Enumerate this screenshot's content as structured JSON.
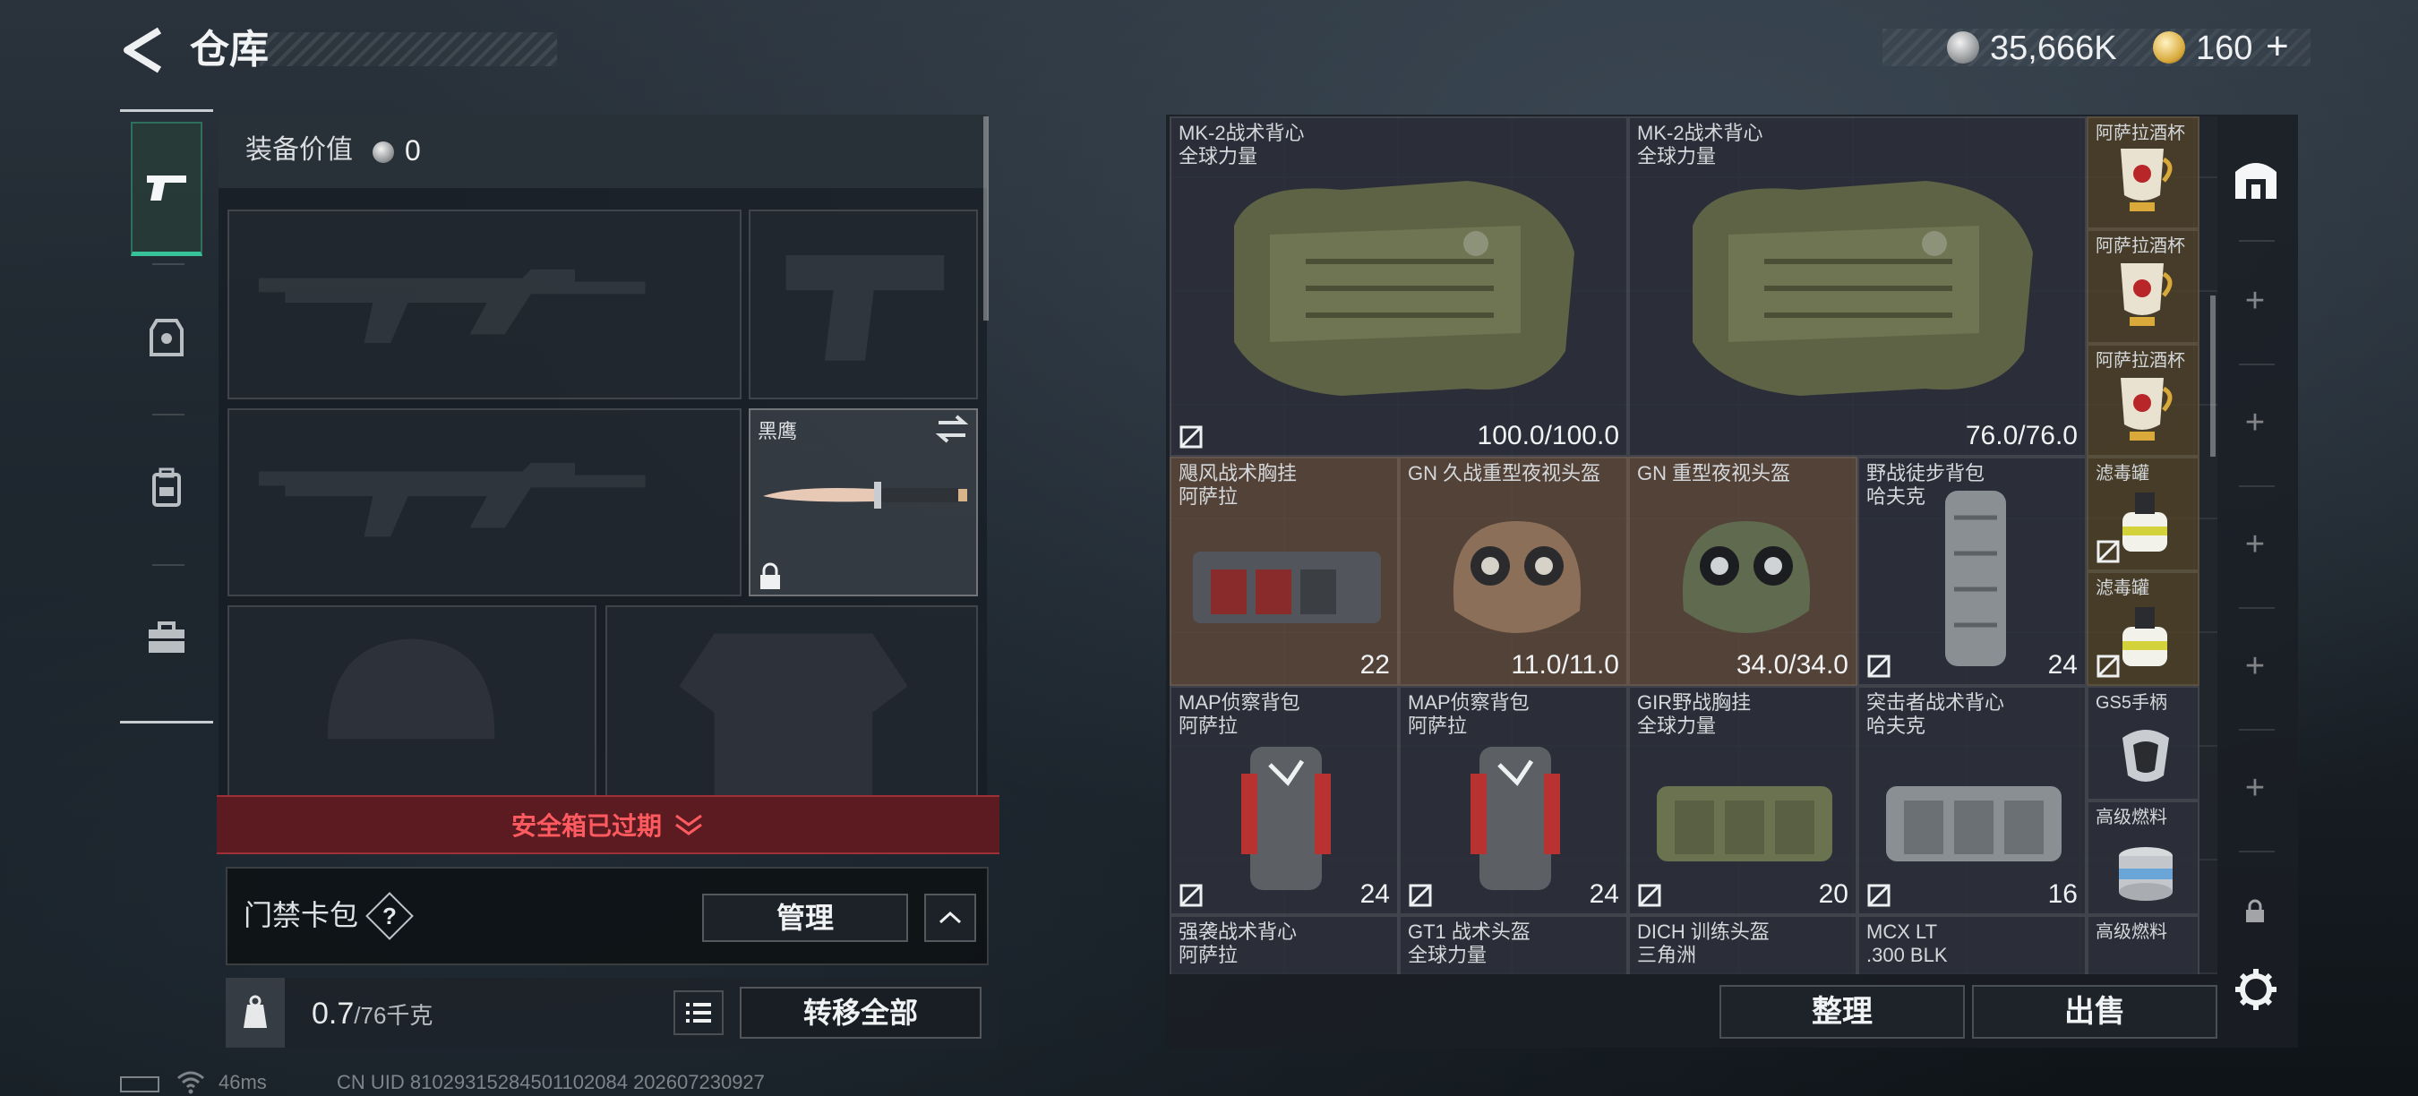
{
  "header": {
    "title": "仓库",
    "currency_silver": "35,666K",
    "currency_gold": "160",
    "currency_plus": "+"
  },
  "nav": {
    "tabs": [
      {
        "name": "weapons",
        "icon": "pistol-icon",
        "active": true
      },
      {
        "name": "gear",
        "icon": "vest-icon",
        "active": false
      },
      {
        "name": "backpack",
        "icon": "backpack-icon",
        "active": false
      },
      {
        "name": "case",
        "icon": "briefcase-icon",
        "active": false
      }
    ]
  },
  "loadout": {
    "value_label": "装备价值",
    "value": "0",
    "melee_name": "黑鹰",
    "safebox_text": "安全箱已过期",
    "keycard_label": "门禁卡包",
    "keycard_help": "?",
    "manage_label": "管理",
    "weight_current": "0.7",
    "weight_max": "/76千克",
    "transfer_all_label": "转移全部"
  },
  "status": {
    "ping": "46ms",
    "uid": "CN UID 8102931528450110208​4 202607230927"
  },
  "stash": {
    "items": [
      {
        "name": "MK-2战术背心",
        "sub": "全球力量",
        "value": "100.0/100.0",
        "theme": "dark",
        "art": "vest"
      },
      {
        "name": "MK-2战术背心",
        "sub": "全球力量",
        "value": "76.0/76.0",
        "theme": "dark",
        "art": "vest"
      },
      {
        "name": "阿萨拉酒杯",
        "sub": "",
        "value": "",
        "theme": "gold",
        "art": "cup"
      },
      {
        "name": "阿萨拉酒杯",
        "sub": "",
        "value": "",
        "theme": "gold",
        "art": "cup"
      },
      {
        "name": "阿萨拉酒杯",
        "sub": "",
        "value": "",
        "theme": "gold",
        "art": "cup"
      },
      {
        "name": "飓风战术胸挂",
        "sub": "阿萨拉",
        "value": "22",
        "theme": "brown",
        "art": "rig"
      },
      {
        "name": "GN 久战重型夜视头盔",
        "sub": "",
        "value": "11.0/11.0",
        "theme": "brown",
        "art": "helmet"
      },
      {
        "name": "GN 重型夜视头盔",
        "sub": "",
        "value": "34.0/34.0",
        "theme": "brown",
        "art": "helmet2"
      },
      {
        "name": "野战徒步背包",
        "sub": "哈夫克",
        "value": "24",
        "theme": "dark",
        "art": "pack"
      },
      {
        "name": "滤毒罐",
        "sub": "",
        "value": "",
        "theme": "gold",
        "art": "canister"
      },
      {
        "name": "滤毒罐",
        "sub": "",
        "value": "",
        "theme": "gold",
        "art": "canister"
      },
      {
        "name": "MAP侦察背包",
        "sub": "阿萨拉",
        "value": "24",
        "theme": "dark",
        "art": "redpack"
      },
      {
        "name": "MAP侦察背包",
        "sub": "阿萨拉",
        "value": "24",
        "theme": "dark",
        "art": "redpack"
      },
      {
        "name": "GIR野战胸挂",
        "sub": "全球力量",
        "value": "20",
        "theme": "dark",
        "art": "greenrig"
      },
      {
        "name": "突击者战术背心",
        "sub": "哈夫克",
        "value": "16",
        "theme": "dark",
        "art": "greyrig"
      },
      {
        "name": "GS5手柄",
        "sub": "",
        "value": "",
        "theme": "dark",
        "art": "grip"
      },
      {
        "name": "高级燃料",
        "sub": "",
        "value": "",
        "theme": "dark",
        "art": "fuel"
      },
      {
        "name": "强袭战术背心",
        "sub": "阿萨拉",
        "value": "",
        "theme": "dark",
        "art": "none"
      },
      {
        "name": "GT1 战术头盔",
        "sub": "全球力量",
        "value": "",
        "theme": "dark",
        "art": "none"
      },
      {
        "name": "DICH 训练头盔",
        "sub": "三角洲",
        "value": "",
        "theme": "dark",
        "art": "none"
      },
      {
        "name": "MCX LT",
        "sub": ".300 BLK",
        "value": "",
        "theme": "dark",
        "art": "none"
      },
      {
        "name": "高级燃料",
        "sub": "",
        "value": "",
        "theme": "dark",
        "art": "fuel"
      }
    ],
    "organize_label": "整理",
    "sell_label": "出售"
  },
  "colors": {
    "accent_green": "#37c29a",
    "alert_red": "#ff5a5f",
    "item_brown": "#5c483a"
  }
}
